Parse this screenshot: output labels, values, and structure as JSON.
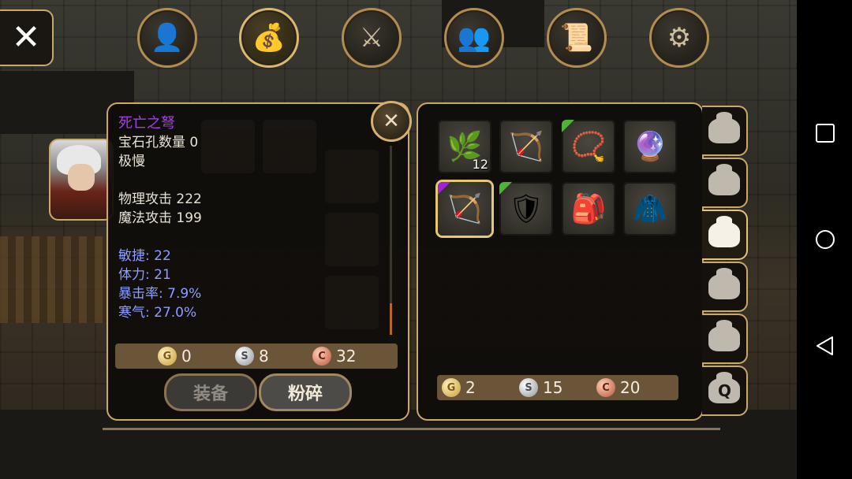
{
  "top_tabs": [
    {
      "icon": "head-icon",
      "active": false
    },
    {
      "icon": "bag-icon",
      "active": true
    },
    {
      "icon": "sword-icon",
      "active": false
    },
    {
      "icon": "party-icon",
      "active": false
    },
    {
      "icon": "scroll-icon",
      "active": false
    },
    {
      "icon": "gear-icon",
      "active": false
    }
  ],
  "item_detail": {
    "name": "死亡之弩",
    "name_color": "#a043e0",
    "gem_slots": "宝石孔数量 0",
    "speed": "极慢",
    "physical_attack": "物理攻击 222",
    "magic_attack": "魔法攻击 199",
    "agility": "敏捷: 22",
    "stamina": "体力: 21",
    "crit_rate": "暴击率: 7.9%",
    "frost": "寒气: 27.0%"
  },
  "sell_price": {
    "gold": "0",
    "silver": "8",
    "copper": "32"
  },
  "buttons": {
    "equip": "装备",
    "smash": "粉碎"
  },
  "inventory": {
    "items": [
      {
        "icon": "herb-icon",
        "glyph": "🌿",
        "quantity": "12",
        "rarity": "none"
      },
      {
        "icon": "crossbow-icon",
        "glyph": "🏹",
        "quantity": "",
        "rarity": "none"
      },
      {
        "icon": "necklace-icon",
        "glyph": "📿",
        "quantity": "",
        "rarity": "green"
      },
      {
        "icon": "amulet-icon",
        "glyph": "🔮",
        "quantity": "",
        "rarity": "none"
      },
      {
        "icon": "death-crossbow-icon",
        "glyph": "🏹",
        "quantity": "",
        "rarity": "purple",
        "selected": true
      },
      {
        "icon": "armor-icon",
        "glyph": "🛡",
        "quantity": "",
        "rarity": "green"
      },
      {
        "icon": "backpack-icon",
        "glyph": "🎒",
        "quantity": "",
        "rarity": "none"
      },
      {
        "icon": "cloak-icon",
        "glyph": "🧥",
        "quantity": "",
        "rarity": "none"
      }
    ],
    "currency": {
      "gold": "2",
      "silver": "15",
      "copper": "20"
    }
  },
  "side_tabs": [
    {
      "icon": "bag-icon",
      "active": false
    },
    {
      "icon": "bag-icon",
      "active": false
    },
    {
      "icon": "bag-icon",
      "active": true
    },
    {
      "icon": "bag-icon",
      "active": false
    },
    {
      "icon": "bag-icon",
      "active": false
    },
    {
      "icon": "quest-bag-icon",
      "active": false,
      "label": "Q"
    }
  ],
  "coin_symbols": {
    "gold": "G",
    "silver": "S",
    "copper": "C"
  },
  "android_nav": [
    "square-icon",
    "circle-icon",
    "back-triangle-icon"
  ]
}
